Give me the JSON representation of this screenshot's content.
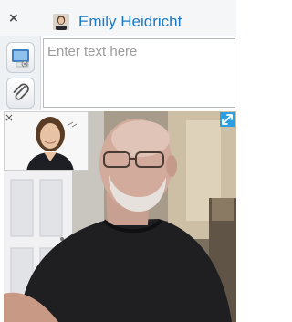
{
  "header": {
    "close_symbol": "×",
    "contact_name": "Emily Heidricht"
  },
  "message": {
    "placeholder": "Enter text here"
  },
  "video": {
    "pip_close_symbol": "×"
  }
}
